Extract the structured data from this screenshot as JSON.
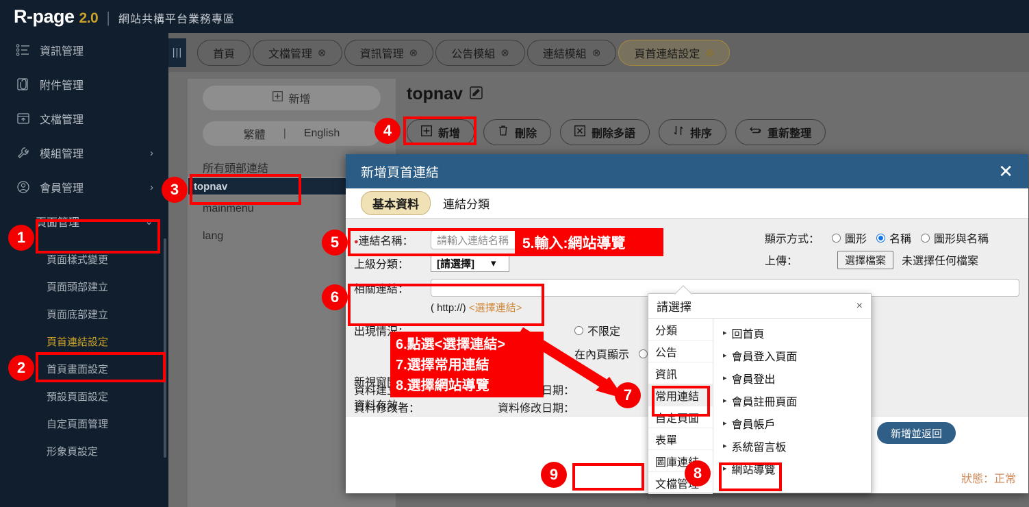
{
  "header": {
    "brand_main": "R-page",
    "brand_version": "2.0",
    "brand_separator": "|",
    "brand_subtitle": "網站共構平台業務專區"
  },
  "sidebar": {
    "items": [
      {
        "label": "資訊管理",
        "icon": "list-icon",
        "chevron": ""
      },
      {
        "label": "附件管理",
        "icon": "attachment-icon",
        "chevron": ""
      },
      {
        "label": "文檔管理",
        "icon": "file-upload-icon",
        "chevron": ""
      },
      {
        "label": "模組管理",
        "icon": "wrench-icon",
        "chevron": "›"
      },
      {
        "label": "會員管理",
        "icon": "user-icon",
        "chevron": "›"
      },
      {
        "label": "頁面管理",
        "icon": "",
        "chevron": "⌄"
      }
    ],
    "subitems": [
      {
        "label": "頁面樣式變更",
        "active": false
      },
      {
        "label": "頁面頭部建立",
        "active": false
      },
      {
        "label": "頁面底部建立",
        "active": false
      },
      {
        "label": "頁首連結設定",
        "active": true
      },
      {
        "label": "首頁畫面設定",
        "active": false
      },
      {
        "label": "預設頁面設定",
        "active": false
      },
      {
        "label": "自定頁面管理",
        "active": false
      },
      {
        "label": "形象頁設定",
        "active": false
      }
    ]
  },
  "tabbar": {
    "collapse_icon": "|||",
    "tabs": [
      {
        "label": "首頁",
        "closable": false,
        "selected": false
      },
      {
        "label": "文檔管理",
        "closable": true,
        "selected": false
      },
      {
        "label": "資訊管理",
        "closable": true,
        "selected": false
      },
      {
        "label": "公告模組",
        "closable": true,
        "selected": false
      },
      {
        "label": "連結模組",
        "closable": true,
        "selected": false
      },
      {
        "label": "頁首連結設定",
        "closable": true,
        "selected": true
      }
    ],
    "close_glyph": "⊗"
  },
  "left_panel": {
    "add_button": "新增",
    "add_icon": "plus-box-icon",
    "lang_tw": "繁體",
    "lang_sep": "|",
    "lang_en": "English",
    "tree_head": "所有頭部連結",
    "tree_items": [
      {
        "label": "topnav",
        "selected": true
      },
      {
        "label": "mainmenu",
        "selected": false
      },
      {
        "label": "lang",
        "selected": false
      }
    ]
  },
  "right_panel": {
    "page_title": "topnav",
    "edit_icon": "pencil-square-icon",
    "toolbar": [
      {
        "label": "新增",
        "icon": "plus-box-icon"
      },
      {
        "label": "刪除",
        "icon": "trash-icon"
      },
      {
        "label": "刪除多語",
        "icon": "x-box-icon"
      },
      {
        "label": "排序",
        "icon": "sort-icon"
      },
      {
        "label": "重新整理",
        "icon": "refresh-icon"
      }
    ]
  },
  "modal": {
    "title": "新增頁首連結",
    "close_glyph": "✕",
    "tabs": [
      {
        "label": "基本資料",
        "active": true
      },
      {
        "label": "連結分類",
        "active": false
      }
    ],
    "fields": {
      "link_name_label": "連結名稱：",
      "link_name_placeholder": "請輸入連結名稱",
      "link_name_value": "",
      "parent_cat_label": "上級分類：",
      "parent_cat_value": "[請選擇]",
      "related_link_label": "相關連結：",
      "related_link_value": "",
      "related_hint_prefix": "( http://)",
      "related_hint_pick": "<選擇連結>",
      "appear_label": "出現情況：",
      "newwindow_label": "新視窗開啟：",
      "valid_label": "資料有效：",
      "unlimited_1": "不限定",
      "inner_show": "在內頁顯示",
      "unlimited_2": "不限定"
    },
    "display_mode": {
      "label": "顯示方式：",
      "options": [
        {
          "label": "圖形",
          "checked": false
        },
        {
          "label": "名稱",
          "checked": true
        },
        {
          "label": "圖形與名稱",
          "checked": false
        }
      ]
    },
    "upload": {
      "label": "上傳：",
      "button": "選擇檔案",
      "status": "未選擇任何檔案"
    },
    "meta": {
      "creator_label": "資料建立者：",
      "creator_value": "",
      "create_date_label": "資料建立日期：",
      "create_date_value": "",
      "modifier_label": "資料修改者：",
      "modifier_value": "",
      "modify_date_label": "資料修改日期：",
      "modify_date_value": ""
    },
    "submit_button": "新增並返回",
    "status_text": "狀態：正常"
  },
  "picker": {
    "title": "請選擇",
    "close_glyph": "×",
    "categories": [
      {
        "label": "分類",
        "active": false
      },
      {
        "label": "公告",
        "active": false
      },
      {
        "label": "資訊",
        "active": false
      },
      {
        "label": "常用連結",
        "active": true
      },
      {
        "label": "自定頁面",
        "active": false
      },
      {
        "label": "表單",
        "active": false
      },
      {
        "label": "圖庫連結",
        "active": false
      },
      {
        "label": "文檔管理",
        "active": false
      }
    ],
    "items": [
      {
        "label": "回首頁"
      },
      {
        "label": "會員登入頁面"
      },
      {
        "label": "會員登出"
      },
      {
        "label": "會員註冊頁面"
      },
      {
        "label": "會員帳戶"
      },
      {
        "label": "系統留言板"
      },
      {
        "label": "網站導覽"
      }
    ],
    "caret": "▸"
  },
  "annotations": {
    "badges": [
      "1",
      "2",
      "3",
      "4",
      "5",
      "6",
      "7",
      "8",
      "9"
    ],
    "note_5": "5.輸入:網站導覽",
    "note_6": "6.點選<選擇連結>",
    "note_7": "7.選擇常用連結",
    "note_8": "8.選擇網站導覽",
    "highlight_color": "#fa0000"
  }
}
